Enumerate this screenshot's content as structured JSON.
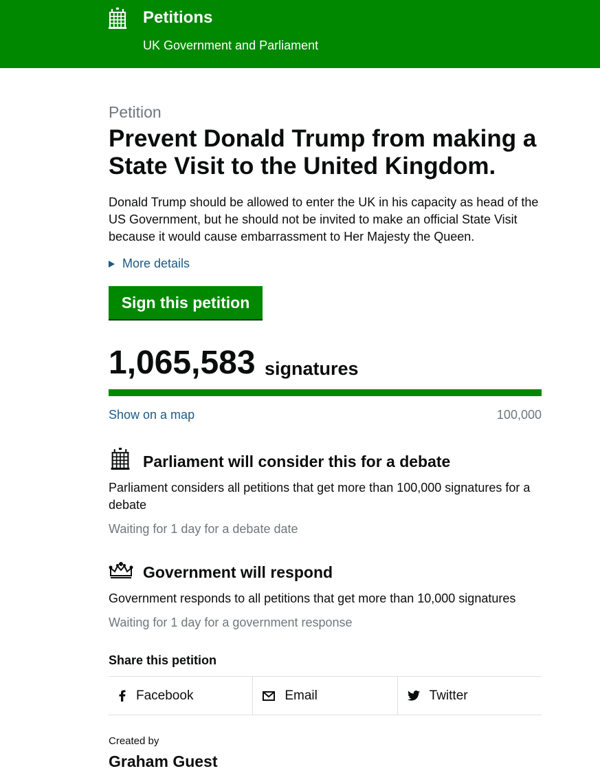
{
  "header": {
    "title": "Petitions",
    "subtitle": "UK Government and Parliament",
    "background": "#008800"
  },
  "petition": {
    "kicker": "Petition",
    "title": "Prevent Donald Trump from making a State Visit to the United Kingdom.",
    "summary": "Donald Trump should be allowed to enter the UK in his capacity as head of the US Government, but he should not be invited to make an official State Visit because it would cause embarrassment to Her Majesty the Queen.",
    "more_details": "More details",
    "sign_button": "Sign this petition"
  },
  "signatures": {
    "count": "1,065,583",
    "label": "signatures",
    "progress_percent": 100,
    "map_link": "Show on a map",
    "threshold": "100,000"
  },
  "sections": [
    {
      "icon": "portcullis-icon",
      "title": "Parliament will consider this for a debate",
      "body": "Parliament considers all petitions that get more than 100,000 signatures for a debate",
      "status": "Waiting for 1 day for a debate date"
    },
    {
      "icon": "crown-icon",
      "title": "Government will respond",
      "body": "Government responds to all petitions that get more than 10,000 signatures",
      "status": "Waiting for 1 day for a government response"
    }
  ],
  "share": {
    "heading": "Share this petition",
    "items": [
      {
        "icon": "facebook-icon",
        "label": "Facebook"
      },
      {
        "icon": "email-icon",
        "label": "Email"
      },
      {
        "icon": "twitter-icon",
        "label": "Twitter"
      }
    ]
  },
  "creator": {
    "label": "Created by",
    "name": "Graham Guest"
  },
  "colors": {
    "brand_green": "#008800",
    "link_blue": "#1d5a86",
    "secondary_text": "#6f777b"
  }
}
